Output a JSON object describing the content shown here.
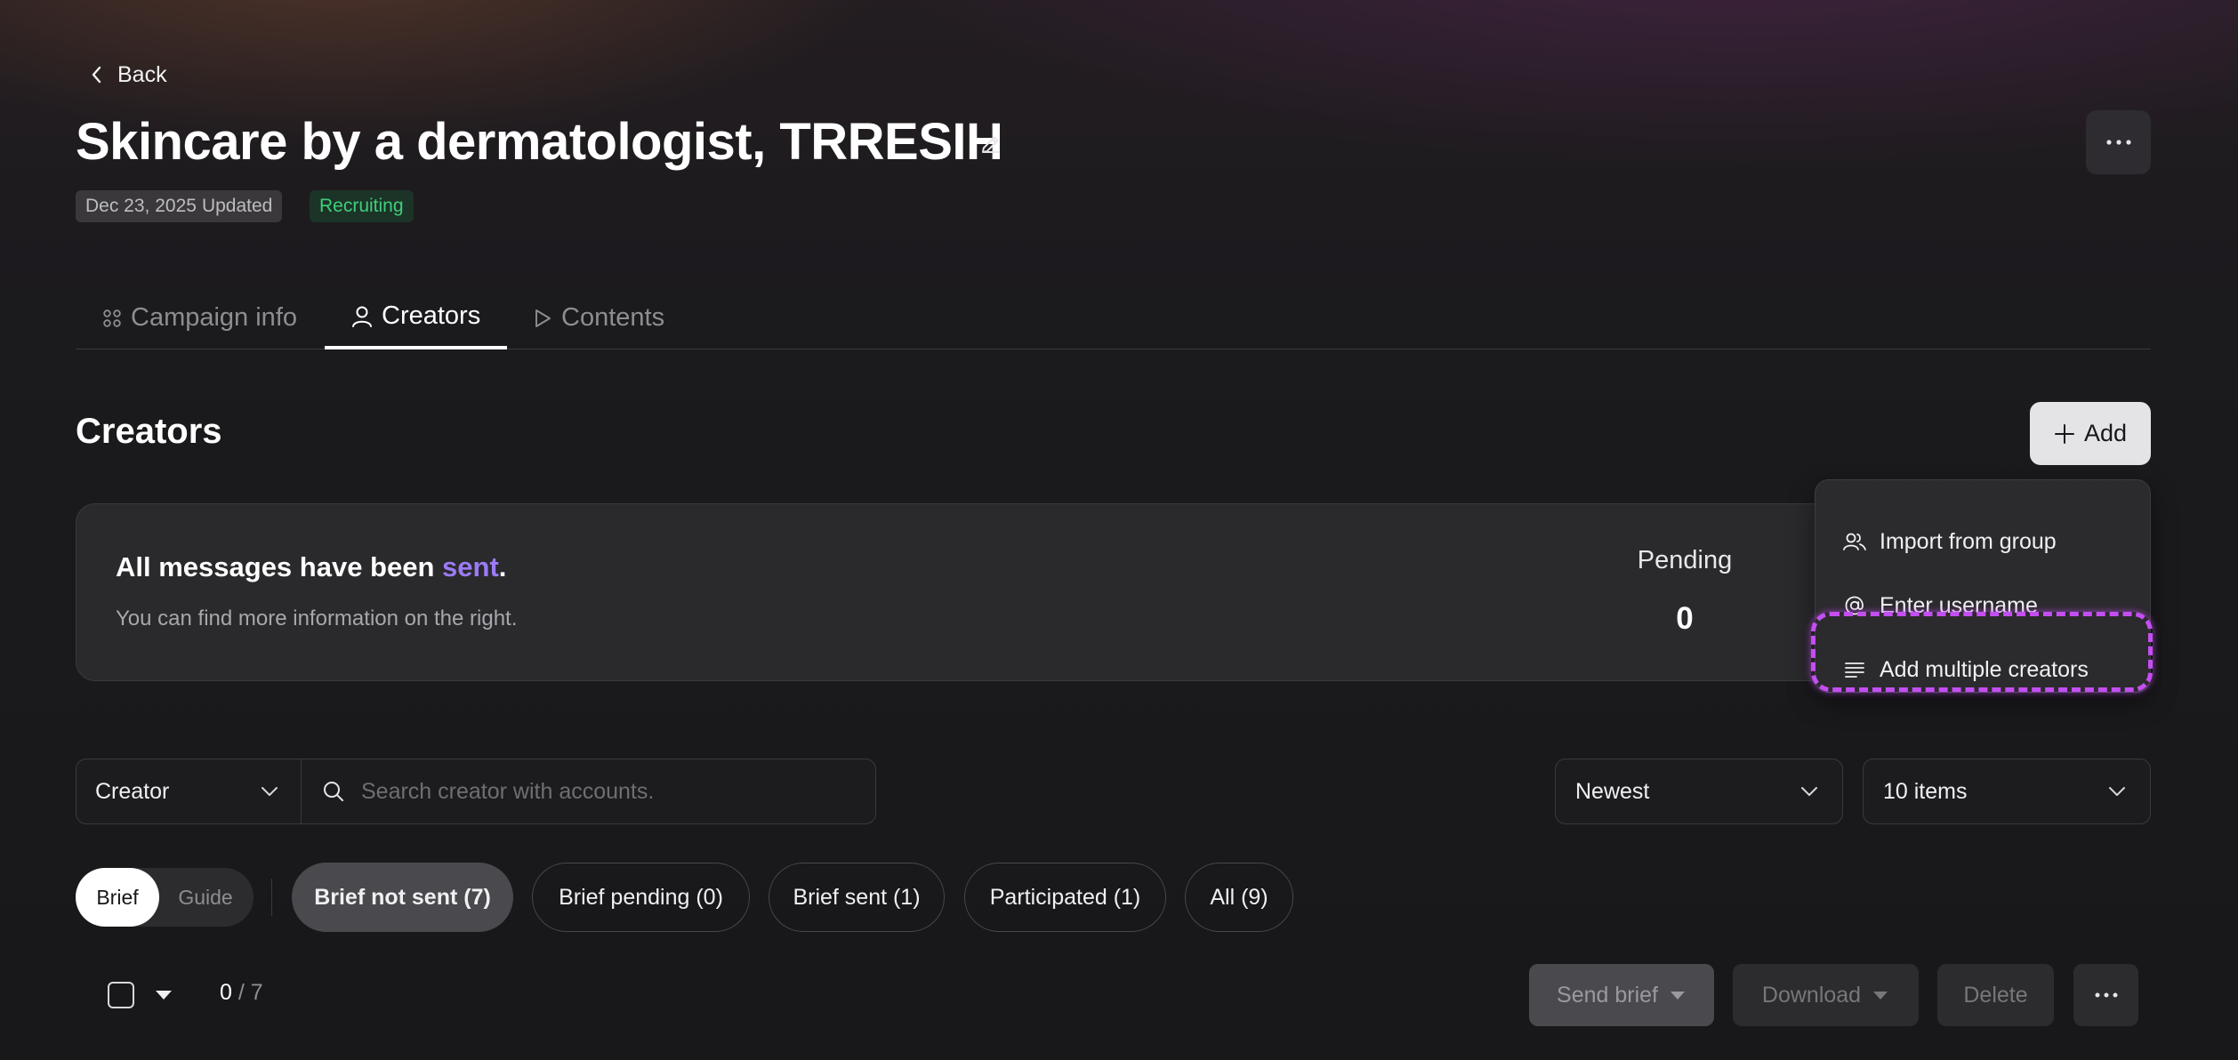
{
  "header": {
    "back_label": "Back",
    "title": "Skincare by a dermatologist, TRRESIH",
    "updated_date": "Dec 23, 2025",
    "updated_label": "Updated",
    "status": "Recruiting"
  },
  "tabs": [
    {
      "label": "Campaign info",
      "icon": "grid-icon",
      "active": false
    },
    {
      "label": "Creators",
      "icon": "person-icon",
      "active": true
    },
    {
      "label": "Contents",
      "icon": "play-icon",
      "active": false
    }
  ],
  "section": {
    "title": "Creators",
    "add_label": "Add"
  },
  "info_card": {
    "headline_prefix": "All messages have been ",
    "headline_accent": "sent",
    "headline_suffix": ".",
    "subtext": "You can find more information on the right.",
    "pending_label": "Pending",
    "pending_value": "0"
  },
  "add_menu": {
    "items": [
      {
        "label": "Import from group",
        "icon": "group-icon"
      },
      {
        "label": "Enter username",
        "icon": "at-icon"
      },
      {
        "label": "Add multiple creators",
        "icon": "lines-icon",
        "highlighted": true
      }
    ]
  },
  "filters": {
    "field_select": "Creator",
    "search_placeholder": "Search creator with accounts.",
    "sort_select": "Newest",
    "page_size_select": "10 items"
  },
  "toggle": {
    "on": "Brief",
    "off": "Guide"
  },
  "status_filters": [
    {
      "label": "Brief not sent (7)",
      "active": true
    },
    {
      "label": "Brief pending (0)",
      "active": false
    },
    {
      "label": "Brief sent (1)",
      "active": false
    },
    {
      "label": "Participated (1)",
      "active": false
    },
    {
      "label": "All (9)",
      "active": false
    }
  ],
  "toolbar": {
    "selected": "0",
    "total": "/ 7",
    "send_brief": "Send brief",
    "download": "Download",
    "delete": "Delete"
  },
  "colors": {
    "accent": "#9b7bf5",
    "status_green": "#3ecf7a",
    "highlight": "#c44ef2"
  }
}
